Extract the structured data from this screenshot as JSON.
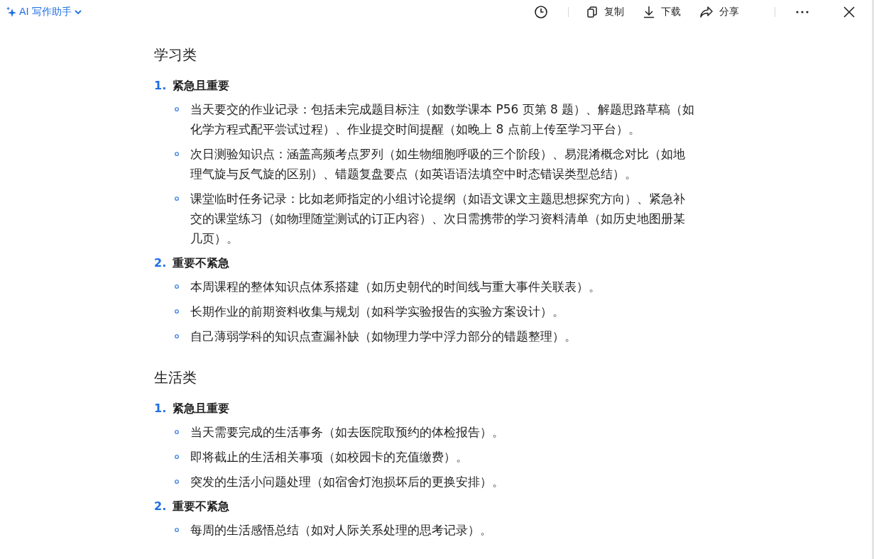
{
  "toolbar": {
    "title": "AI 写作助手",
    "actions": [
      {
        "kind": "history"
      },
      {
        "kind": "copy",
        "label": "复制"
      },
      {
        "kind": "download",
        "label": "下载"
      },
      {
        "kind": "share",
        "label": "分享"
      },
      {
        "kind": "more"
      },
      {
        "kind": "close"
      }
    ]
  },
  "sections": [
    {
      "heading": "学习类",
      "groups": [
        {
          "number": "1.",
          "title": "紧急且重要",
          "items": [
            "当天要交的作业记录：包括未完成题目标注（如数学课本 P56 页第 8 题）、解题思路草稿（如化学方程式配平尝试过程）、作业提交时间提醒（如晚上 8 点前上传至学习平台）。",
            "次日测验知识点：涵盖高频考点罗列（如生物细胞呼吸的三个阶段）、易混淆概念对比（如地理气旋与反气旋的区别）、错题复盘要点（如英语语法填空中时态错误类型总结）。",
            "课堂临时任务记录：比如老师指定的小组讨论提纲（如语文课文主题思想探究方向）、紧急补交的课堂练习（如物理随堂测试的订正内容）、次日需携带的学习资料清单（如历史地图册某几页）。"
          ]
        },
        {
          "number": "2.",
          "title": "重要不紧急",
          "items": [
            "本周课程的整体知识点体系搭建（如历史朝代的时间线与重大事件关联表）。",
            "长期作业的前期资料收集与规划（如科学实验报告的实验方案设计）。",
            "自己薄弱学科的知识点查漏补缺（如物理力学中浮力部分的错题整理）。"
          ]
        }
      ]
    },
    {
      "heading": "生活类",
      "groups": [
        {
          "number": "1.",
          "title": "紧急且重要",
          "items": [
            "当天需要完成的生活事务（如去医院取预约的体检报告）。",
            "即将截止的生活相关事项（如校园卡的充值缴费）。",
            "突发的生活小问题处理（如宿舍灯泡损坏后的更换安排）。"
          ]
        },
        {
          "number": "2.",
          "title": "重要不紧急",
          "items": [
            "每周的生活感悟总结（如对人际关系处理的思考记录）。"
          ]
        }
      ]
    }
  ]
}
